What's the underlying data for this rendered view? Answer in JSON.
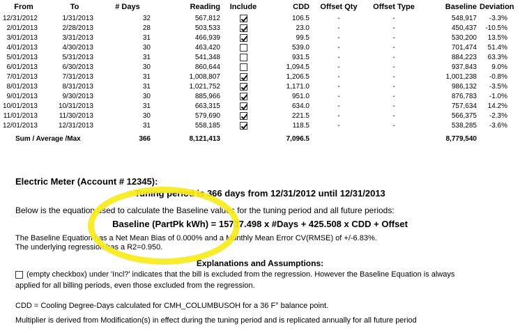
{
  "table": {
    "headers": {
      "from": "From",
      "to": "To",
      "days": "# Days",
      "reading": "Reading",
      "include": "Include",
      "cdd": "CDD",
      "offset_qty": "Offset Qty",
      "offset_type": "Offset Type",
      "baseline": "Baseline",
      "deviation": "Deviation"
    },
    "rows": [
      {
        "from": "12/31/2012",
        "to": "1/31/2013",
        "days": "32",
        "reading": "567,812",
        "include": true,
        "cdd": "106.5",
        "offset_qty": "-",
        "offset_type": "-",
        "baseline": "548,917",
        "deviation": "-3.3%"
      },
      {
        "from": "2/01/2013",
        "to": "2/28/2013",
        "days": "28",
        "reading": "503,533",
        "include": true,
        "cdd": "23.0",
        "offset_qty": "-",
        "offset_type": "-",
        "baseline": "450,437",
        "deviation": "-10.5%"
      },
      {
        "from": "3/01/2013",
        "to": "3/31/2013",
        "days": "31",
        "reading": "466,939",
        "include": true,
        "cdd": "99.5",
        "offset_qty": "-",
        "offset_type": "-",
        "baseline": "530,200",
        "deviation": "13.5%"
      },
      {
        "from": "4/01/2013",
        "to": "4/30/2013",
        "days": "30",
        "reading": "463,420",
        "include": false,
        "cdd": "539.0",
        "offset_qty": "-",
        "offset_type": "-",
        "baseline": "701,474",
        "deviation": "51.4%"
      },
      {
        "from": "5/01/2013",
        "to": "5/31/2013",
        "days": "31",
        "reading": "541,348",
        "include": false,
        "cdd": "931.5",
        "offset_qty": "-",
        "offset_type": "-",
        "baseline": "884,223",
        "deviation": "63.3%"
      },
      {
        "from": "6/01/2013",
        "to": "6/30/2013",
        "days": "30",
        "reading": "860,644",
        "include": false,
        "cdd": "1,094.5",
        "offset_qty": "-",
        "offset_type": "-",
        "baseline": "937,843",
        "deviation": "9.0%"
      },
      {
        "from": "7/01/2013",
        "to": "7/31/2013",
        "days": "31",
        "reading": "1,008,807",
        "include": true,
        "cdd": "1,206.5",
        "offset_qty": "-",
        "offset_type": "-",
        "baseline": "1,001,238",
        "deviation": "-0.8%"
      },
      {
        "from": "8/01/2013",
        "to": "8/31/2013",
        "days": "31",
        "reading": "1,021,752",
        "include": true,
        "cdd": "1,171.0",
        "offset_qty": "-",
        "offset_type": "-",
        "baseline": "986,132",
        "deviation": "-3.5%"
      },
      {
        "from": "9/01/2013",
        "to": "9/30/2013",
        "days": "30",
        "reading": "885,966",
        "include": true,
        "cdd": "951.0",
        "offset_qty": "-",
        "offset_type": "-",
        "baseline": "876,783",
        "deviation": "-1.0%"
      },
      {
        "from": "10/01/2013",
        "to": "10/31/2013",
        "days": "31",
        "reading": "663,315",
        "include": true,
        "cdd": "634.0",
        "offset_qty": "-",
        "offset_type": "-",
        "baseline": "757,634",
        "deviation": "14.2%"
      },
      {
        "from": "11/01/2013",
        "to": "11/30/2013",
        "days": "30",
        "reading": "579,690",
        "include": true,
        "cdd": "221.5",
        "offset_qty": "-",
        "offset_type": "-",
        "baseline": "566,375",
        "deviation": "-2.3%"
      },
      {
        "from": "12/01/2013",
        "to": "12/31/2013",
        "days": "31",
        "reading": "558,185",
        "include": true,
        "cdd": "118.5",
        "offset_qty": "-",
        "offset_type": "-",
        "baseline": "538,285",
        "deviation": "-3.6%"
      }
    ],
    "totals": {
      "label": "Sum / Average /Max",
      "days": "366",
      "reading": "8,121,413",
      "cdd": "7,096.5",
      "baseline": "8,779,540"
    }
  },
  "meter": {
    "title": "Electric Meter (Account # 12345):",
    "tuning_text": "Tuning period is 366 days from 12/31/2012 until 12/31/2013",
    "equation_intro": "Below is the equation used to calculate the Baseline values for the tuning period and all future periods:",
    "equation": "Baseline (PartPk kWh) = 15737.498 x #Days + 425.508 x CDD + Offset",
    "bias_text": "The Baseline Equation has a Net Mean Bias of 0.000% and a Monthly Mean Error CV(RMSE) of +/-6.83%.",
    "r2_text": "The underlying regression has a R2=0.950."
  },
  "explanations": {
    "title": "Explanations and Assumptions:",
    "line1": "(empty checkbox) under 'Incl?' indicates that the bill is excluded from the regression.  However the Baseline Equation is always",
    "line2": "applied for all billing periods, even those excluded from the regression.",
    "cdd_text": "CDD = Cooling Degree-Days calculated for CMH_COLUMBUSOH for a 36 F° balance point.",
    "multiplier_text": "Multiplier is derived from Modification(s) in effect during the tuning period and is replicated annually for all future period"
  },
  "colors": {
    "highlight": "#f6ea1c"
  }
}
